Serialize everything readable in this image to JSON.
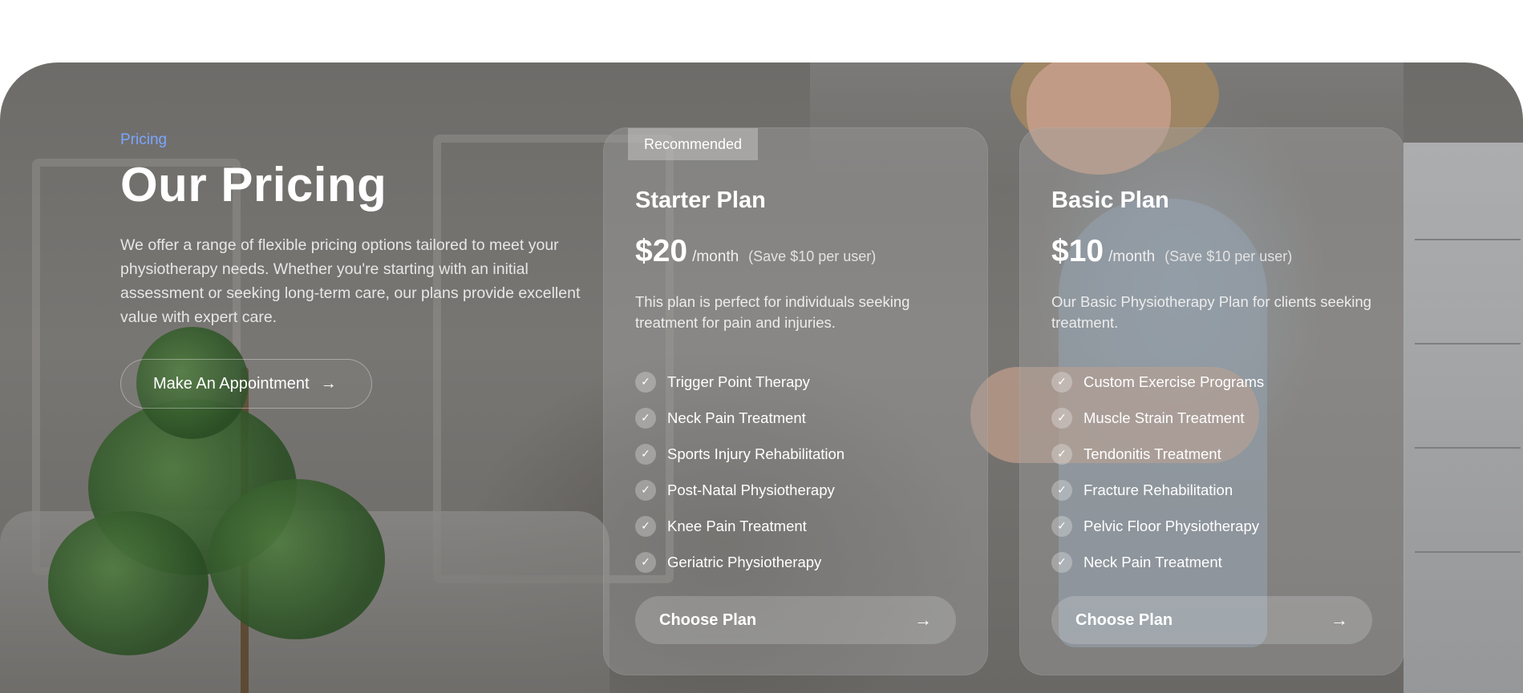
{
  "intro": {
    "eyebrow": "Pricing",
    "title": "Our Pricing",
    "description": "We offer a range of flexible pricing options tailored to meet your physiotherapy needs. Whether you're starting with an initial assessment or seeking long-term care, our plans provide excellent value with expert care.",
    "cta_label": "Make An Appointment",
    "cta_icon": "arrow-right-icon"
  },
  "plans": [
    {
      "badge": "Recommended",
      "name": "Starter Plan",
      "price": "$20",
      "period": "/month",
      "savings": "(Save $10 per user)",
      "description": "This plan is perfect for individuals seeking treatment for pain and injuries.",
      "features": [
        "Trigger Point Therapy",
        "Neck Pain Treatment",
        "Sports Injury Rehabilitation",
        "Post-Natal Physiotherapy",
        "Knee Pain Treatment",
        "Geriatric Physiotherapy"
      ],
      "button_label": "Choose Plan"
    },
    {
      "badge": "",
      "name": "Basic Plan",
      "price": "$10",
      "period": "/month",
      "savings": "(Save $10 per user)",
      "description": "Our Basic Physiotherapy Plan for clients seeking treatment.",
      "features": [
        "Custom Exercise Programs",
        "Muscle Strain Treatment",
        "Tendonitis Treatment",
        "Fracture Rehabilitation",
        "Pelvic Floor Physiotherapy",
        "Neck Pain Treatment"
      ],
      "button_label": "Choose Plan"
    }
  ],
  "colors": {
    "accent": "#7aa6ff",
    "text": "#ffffff"
  },
  "icons": {
    "feature": "check-icon",
    "button": "arrow-right-icon"
  }
}
